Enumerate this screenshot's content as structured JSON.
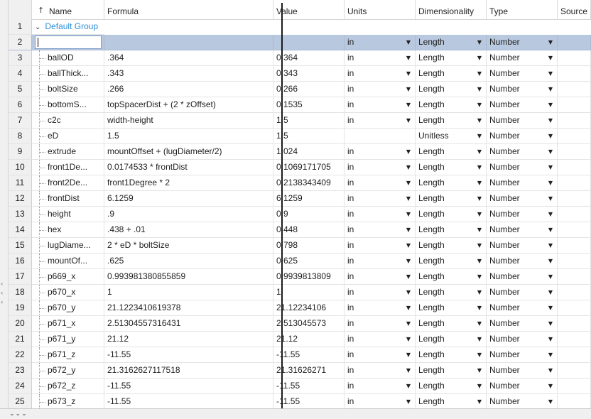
{
  "columns": {
    "name": "Name",
    "formula": "Formula",
    "value": "Value",
    "units": "Units",
    "dimensionality": "Dimensionality",
    "type": "Type",
    "source": "Source"
  },
  "icons": {
    "sort": "↑",
    "expand": "⌄",
    "dropdown": "▼",
    "left_arrows": "‹‹‹",
    "tabs": "⌄⌄⌄"
  },
  "group_row": {
    "num": "1",
    "label": "Default Group"
  },
  "edit_row": {
    "num": "2",
    "units": "in",
    "dimensionality": "Length",
    "type": "Number"
  },
  "rows": [
    {
      "num": "3",
      "name": "ballOD",
      "formula": ".364",
      "value": "0.364",
      "units": "in",
      "dim": "Length",
      "type": "Number"
    },
    {
      "num": "4",
      "name": "ballThick...",
      "formula": ".343",
      "value": "0.343",
      "units": "in",
      "dim": "Length",
      "type": "Number"
    },
    {
      "num": "5",
      "name": "boltSize",
      "formula": ".266",
      "value": "0.266",
      "units": "in",
      "dim": "Length",
      "type": "Number"
    },
    {
      "num": "6",
      "name": "bottomS...",
      "formula": "topSpacerDist + (2 * zOffset)",
      "value": "0.1535",
      "units": "in",
      "dim": "Length",
      "type": "Number"
    },
    {
      "num": "7",
      "name": "c2c",
      "formula": "width-height",
      "value": "1.5",
      "units": "in",
      "dim": "Length",
      "type": "Number"
    },
    {
      "num": "8",
      "name": "eD",
      "formula": "1.5",
      "value": "1.5",
      "units": "",
      "dim": "Unitless",
      "type": "Number"
    },
    {
      "num": "9",
      "name": "extrude",
      "formula": "mountOffset + (lugDiameter/2)",
      "value": "1.024",
      "units": "in",
      "dim": "Length",
      "type": "Number"
    },
    {
      "num": "10",
      "name": "front1De...",
      "formula": "0.0174533 * frontDist",
      "value": "0.1069171705",
      "units": "in",
      "dim": "Length",
      "type": "Number"
    },
    {
      "num": "11",
      "name": "front2De...",
      "formula": "front1Degree * 2",
      "value": "0.2138343409",
      "units": "in",
      "dim": "Length",
      "type": "Number"
    },
    {
      "num": "12",
      "name": "frontDist",
      "formula": "6.1259",
      "value": "6.1259",
      "units": "in",
      "dim": "Length",
      "type": "Number"
    },
    {
      "num": "13",
      "name": "height",
      "formula": ".9",
      "value": "0.9",
      "units": "in",
      "dim": "Length",
      "type": "Number"
    },
    {
      "num": "14",
      "name": "hex",
      "formula": ".438 + .01",
      "value": "0.448",
      "units": "in",
      "dim": "Length",
      "type": "Number"
    },
    {
      "num": "15",
      "name": "lugDiame...",
      "formula": "2 * eD * boltSize",
      "value": "0.798",
      "units": "in",
      "dim": "Length",
      "type": "Number"
    },
    {
      "num": "16",
      "name": "mountOf...",
      "formula": ".625",
      "value": "0.625",
      "units": "in",
      "dim": "Length",
      "type": "Number"
    },
    {
      "num": "17",
      "name": "p669_x",
      "formula": "0.993981380855859",
      "value": "0.9939813809",
      "units": "in",
      "dim": "Length",
      "type": "Number"
    },
    {
      "num": "18",
      "name": "p670_x",
      "formula": "1",
      "value": "1",
      "units": "in",
      "dim": "Length",
      "type": "Number"
    },
    {
      "num": "19",
      "name": "p670_y",
      "formula": "21.1223410619378",
      "value": "21.12234106",
      "units": "in",
      "dim": "Length",
      "type": "Number"
    },
    {
      "num": "20",
      "name": "p671_x",
      "formula": "2.51304557316431",
      "value": "2.513045573",
      "units": "in",
      "dim": "Length",
      "type": "Number"
    },
    {
      "num": "21",
      "name": "p671_y",
      "formula": "21.12",
      "value": "21.12",
      "units": "in",
      "dim": "Length",
      "type": "Number"
    },
    {
      "num": "22",
      "name": "p671_z",
      "formula": "-11.55",
      "value": "-11.55",
      "units": "in",
      "dim": "Length",
      "type": "Number"
    },
    {
      "num": "23",
      "name": "p672_y",
      "formula": "21.3162627117518",
      "value": "21.31626271",
      "units": "in",
      "dim": "Length",
      "type": "Number"
    },
    {
      "num": "24",
      "name": "p672_z",
      "formula": "-11.55",
      "value": "-11.55",
      "units": "in",
      "dim": "Length",
      "type": "Number"
    },
    {
      "num": "25",
      "name": "p673_z",
      "formula": "-11.55",
      "value": "-11.55",
      "units": "in",
      "dim": "Length",
      "type": "Number"
    }
  ],
  "colors": {
    "group_label": "#2f8fd6",
    "selected_row": "#b8c8de",
    "header_bg": "#ffffff",
    "row_number_bg": "#f0f0f0"
  }
}
